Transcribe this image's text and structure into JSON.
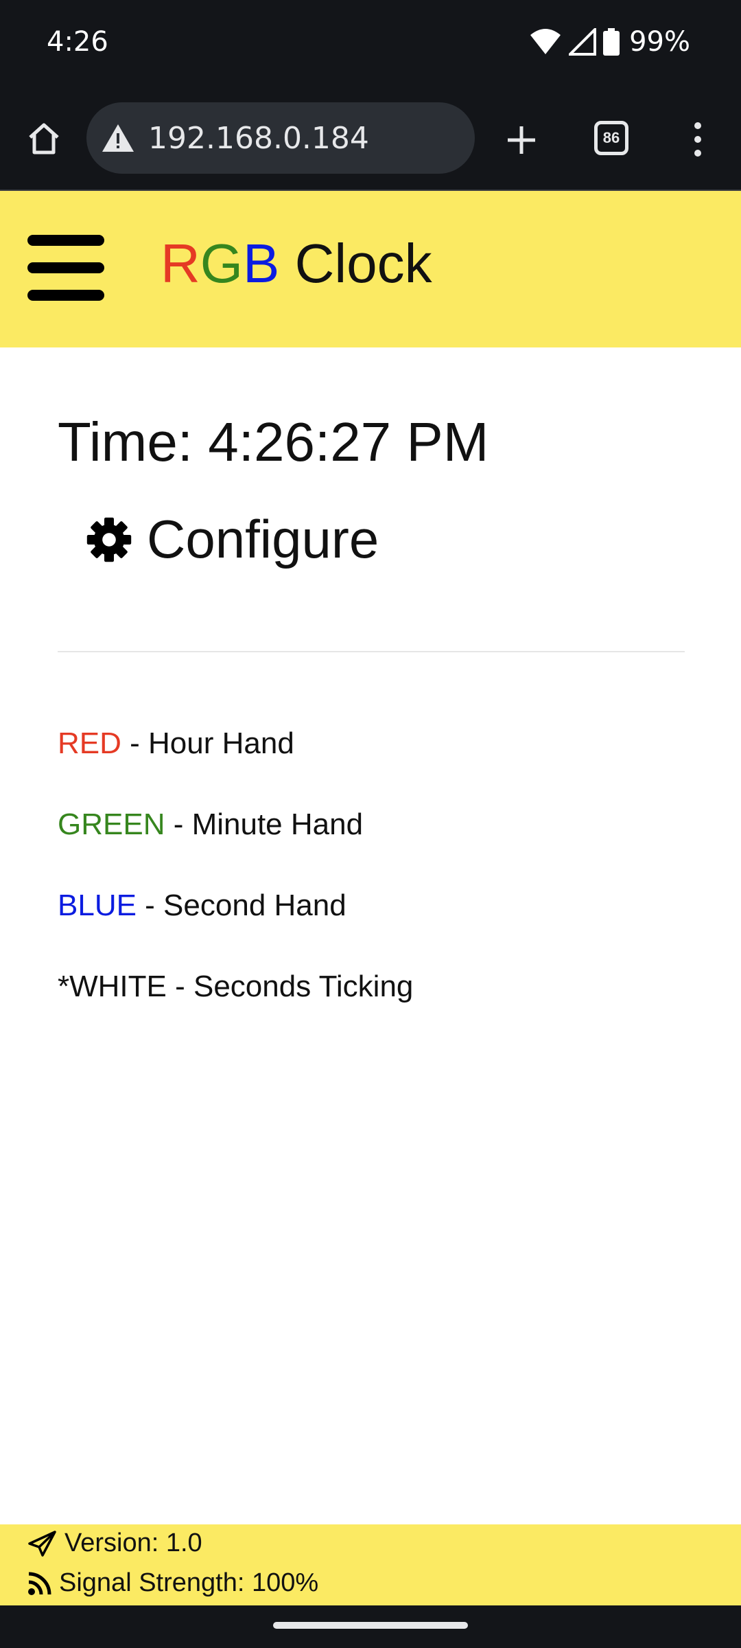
{
  "status_bar": {
    "time": "4:26",
    "battery_percent": "99%",
    "icons": [
      "wifi-icon",
      "cell-signal-icon",
      "battery-icon"
    ]
  },
  "browser": {
    "url": "192.168.0.184",
    "tab_count": "86",
    "icons": [
      "home-icon",
      "warning-icon",
      "plus-icon",
      "tabs-icon",
      "more-vert-icon"
    ]
  },
  "header": {
    "brand_r": "R",
    "brand_g": "G",
    "brand_b": "B",
    "brand_rest": " Clock",
    "colors": {
      "r": "#e53a24",
      "g": "#36861e",
      "b": "#0b1ce0",
      "header_bg": "#fbea63"
    }
  },
  "main": {
    "time_label": "Time: 4:26:27 PM",
    "configure_label": "Configure",
    "legend": [
      {
        "color_word": "RED",
        "desc": " - Hour Hand"
      },
      {
        "color_word": "GREEN",
        "desc": " - Minute Hand"
      },
      {
        "color_word": "BLUE",
        "desc": " - Second Hand"
      },
      {
        "color_word": "*WHITE",
        "desc": " - Seconds Ticking"
      }
    ]
  },
  "footer": {
    "version": "Version: 1.0",
    "signal": "Signal Strength: 100%"
  }
}
